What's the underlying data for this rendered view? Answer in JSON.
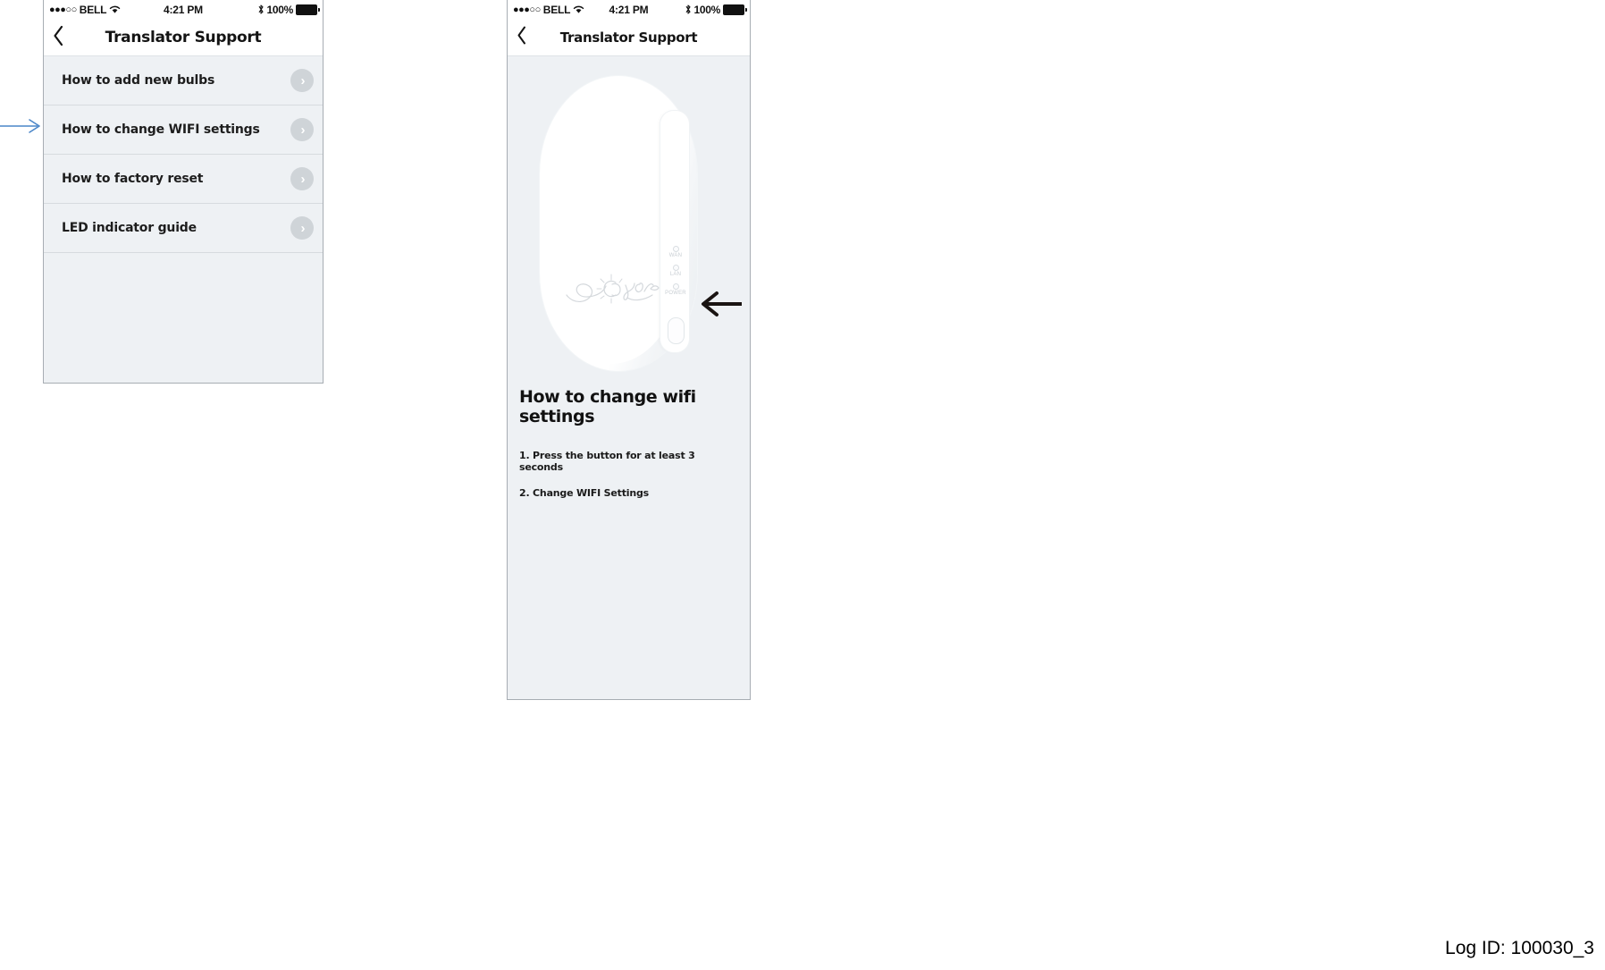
{
  "status_bar": {
    "signal_dots": "●●●○○",
    "carrier": "BELL",
    "wifi_icon": "wifi-icon",
    "time": "4:21 PM",
    "bluetooth_icon": "bluetooth-icon",
    "battery_percent": "100%"
  },
  "colors": {
    "screen_background": "#eef1f4",
    "bar_background": "#ffffff",
    "frame_border": "#a7adb3",
    "row_divider": "#d7dbdf",
    "chevron_circle": "#cfd4d8",
    "annotation_blue": "#4a86c8",
    "annotation_black": "#1a1412",
    "text_primary": "#141414",
    "led_label": "#c8ced3"
  },
  "screen_list": {
    "nav": {
      "back_icon": "chevron-left-icon",
      "title": "Translator Support"
    },
    "rows": [
      {
        "label": "How to add new bulbs",
        "accessory_icon": "chevron-right-icon"
      },
      {
        "label": "How to change WIFI settings",
        "accessory_icon": "chevron-right-icon"
      },
      {
        "label": "How to factory reset",
        "accessory_icon": "chevron-right-icon"
      },
      {
        "label": "LED indicator guide",
        "accessory_icon": "chevron-right-icon"
      }
    ],
    "annotation": {
      "type": "arrow-right",
      "target_row_index": 1,
      "color": "#4a86c8"
    }
  },
  "screen_detail": {
    "nav": {
      "back_icon": "chevron-left-icon",
      "title": "Translator Support"
    },
    "device_illustration": {
      "brand_text": "C by GE",
      "leds": [
        {
          "label": "WAN"
        },
        {
          "label": "LAN"
        },
        {
          "label": "POWER"
        }
      ],
      "button_name": "device-reset-button",
      "annotation": {
        "type": "arrow-left",
        "points_to": "device-reset-button",
        "color": "#1a1412"
      }
    },
    "title": "How to change wifi settings",
    "steps": [
      "1. Press the button for at least 3 seconds",
      "2. Change WIFI Settings"
    ]
  },
  "footer": {
    "log_id": "Log ID: 100030_3"
  }
}
